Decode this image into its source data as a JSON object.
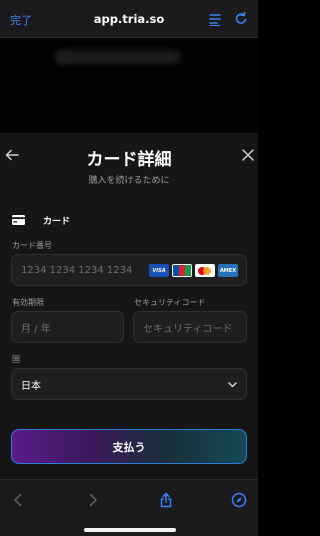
{
  "browser": {
    "done_label": "完了",
    "url": "app.tria.so"
  },
  "sheet": {
    "title": "カード詳細",
    "subtitle": "購入を続けるために",
    "method_label": "カード"
  },
  "form": {
    "card_number_label": "カード番号",
    "card_number_placeholder": "1234 1234 1234 1234",
    "card_brands": [
      "VISA",
      "JCB",
      "Mastercard",
      "AMEX"
    ],
    "expiry_label": "有効期限",
    "expiry_placeholder": "月 / 年",
    "cvc_label": "セキュリティコード",
    "cvc_placeholder": "セキュリティコード",
    "country_label": "国",
    "country_value": "日本"
  },
  "pay_button_label": "支払う",
  "colors": {
    "accent_blue": "#3a82f7",
    "sheet_bg": "#161616",
    "field_bg": "#1f1f1f"
  },
  "icons": {
    "top_left_tabs": "reader-icon",
    "top_right": "reload-icon",
    "bottom": [
      "back-arrow-icon",
      "forward-arrow-icon",
      "share-icon",
      "compass-icon"
    ]
  }
}
